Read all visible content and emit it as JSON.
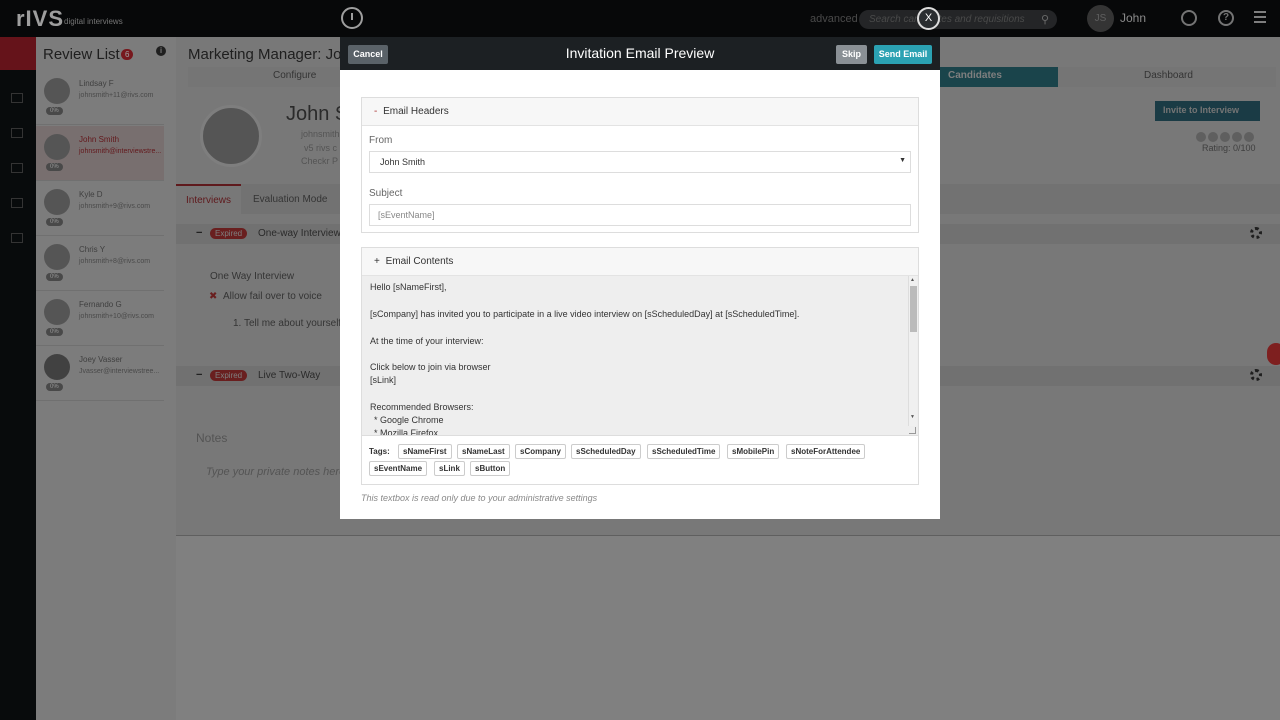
{
  "app": {
    "logo": "rIVS",
    "logo_sub": "digital interviews",
    "search_advanced": "advanced",
    "search_placeholder": "Search candidates and requisitions",
    "user_initials": "JS",
    "user_name": "John",
    "accent_color": "#2ba2b3",
    "brand_color": "#a3202a"
  },
  "review_list": {
    "title": "Review List",
    "badge": "6",
    "candidates": [
      {
        "name": "Lindsay F",
        "email": "johnsmith+11@rivs.com",
        "pct": "0%"
      },
      {
        "name": "John Smith",
        "email": "johnsmith@interviewstre...",
        "pct": "0%"
      },
      {
        "name": "Kyle D",
        "email": "johnsmith+9@rivs.com",
        "pct": "0%"
      },
      {
        "name": "Chris Y",
        "email": "johnsmith+8@rivs.com",
        "pct": "0%"
      },
      {
        "name": "Fernando G",
        "email": "johnsmith+10@rivs.com",
        "pct": "0%"
      },
      {
        "name": "Joey Vasser",
        "email": "Jvasser@interviewstree...",
        "pct": "0%"
      }
    ]
  },
  "main": {
    "title": "Marketing Manager: Jo",
    "steps": [
      "Configure",
      "Candidates",
      "Dashboard"
    ],
    "invite_button": "Invite to Interview",
    "rating": "Rating: 0/100",
    "profile_name": "John S",
    "profile_lines": [
      "johnsmith",
      "v5 rivs c",
      "Checkr P"
    ],
    "tabs": [
      "Interviews",
      "Evaluation Mode"
    ],
    "sections": [
      {
        "status": "Expired",
        "label": "One-way Interview"
      },
      {
        "status": "Expired",
        "label": "Live Two-Way"
      }
    ],
    "one_way_title": "One Way Interview",
    "allow_fail": "Allow fail over to voice",
    "question": "1. Tell me about yourself",
    "notes_title": "Notes",
    "notes_placeholder": "Type your private notes here"
  },
  "modal": {
    "title": "Invitation Email Preview",
    "cancel": "Cancel",
    "skip": "Skip",
    "send": "Send Email",
    "close": "X",
    "headers_section": "Email Headers",
    "headers_sign": "-",
    "from_label": "From",
    "from_value": "John Smith",
    "subject_label": "Subject",
    "subject_value": "[sEventName]",
    "contents_section": "Email Contents",
    "contents_sign": "+",
    "body_lines": [
      "Hello [sNameFirst],",
      "[sCompany] has invited you to participate in a live video interview on [sScheduledDay] at [sScheduledTime].",
      "At the time of your interview:",
      "Click below to join via browser",
      "[sLink]",
      "Recommended Browsers:",
      "* Google Chrome",
      "* Mozilla Firefox"
    ],
    "tags_label": "Tags:",
    "tags": [
      "sNameFirst",
      "sNameLast",
      "sCompany",
      "sScheduledDay",
      "sScheduledTime",
      "sMobilePin",
      "sNoteForAttendee",
      "sEventName",
      "sLink",
      "sButton"
    ],
    "readonly_note": "This textbox is read only due to your administrative settings"
  }
}
